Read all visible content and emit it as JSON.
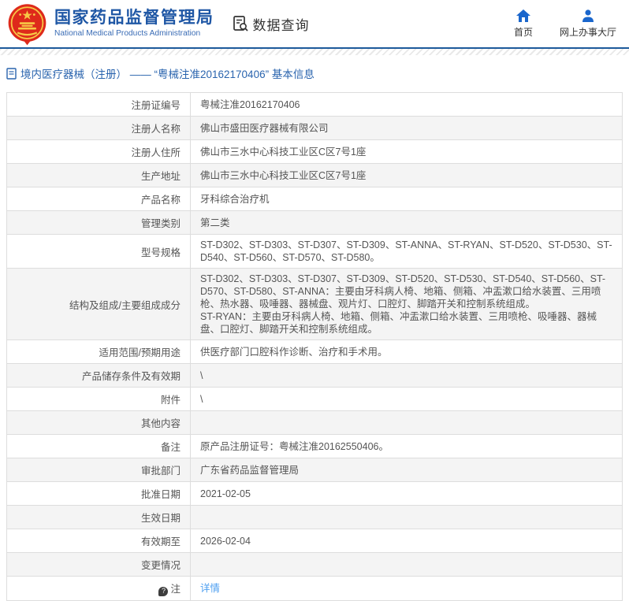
{
  "header": {
    "agency_name_cn": "国家药品监督管理局",
    "agency_name_en": "National Medical Products Administration",
    "section_title": "数据查询",
    "nav": [
      {
        "icon": "home-icon",
        "label": "首页"
      },
      {
        "icon": "user-icon",
        "label": "网上办事大厅"
      }
    ]
  },
  "breadcrumb": {
    "text": "境内医疗器械（注册） —— “粤械注准20162170406” 基本信息"
  },
  "table": {
    "rows": [
      {
        "label": "注册证编号",
        "value": "粤械注准20162170406"
      },
      {
        "label": "注册人名称",
        "value": "佛山市盛田医疗器械有限公司"
      },
      {
        "label": "注册人住所",
        "value": "佛山市三水中心科技工业区C区7号1座"
      },
      {
        "label": "生产地址",
        "value": "佛山市三水中心科技工业区C区7号1座"
      },
      {
        "label": "产品名称",
        "value": "牙科综合治疗机"
      },
      {
        "label": "管理类别",
        "value": "第二类"
      },
      {
        "label": "型号规格",
        "value": "ST-D302、ST-D303、ST-D307、ST-D309、ST-ANNA、ST-RYAN、ST-D520、ST-D530、ST-D540、ST-D560、ST-D570、ST-D580。"
      },
      {
        "label": "结构及组成/主要组成成分",
        "value": "ST-D302、ST-D303、ST-D307、ST-D309、ST-D520、ST-D530、ST-D540、ST-D560、ST-D570、ST-D580、ST-ANNA：主要由牙科病人椅、地箱、侧箱、冲盂漱口给水装置、三用喷枪、热水器、吸唾器、器械盘、观片灯、口腔灯、脚踏开关和控制系统组成。\nST-RYAN：主要由牙科病人椅、地箱、侧箱、冲盂漱口给水装置、三用喷枪、吸唾器、器械盘、口腔灯、脚踏开关和控制系统组成。"
      },
      {
        "label": "适用范围/预期用途",
        "value": "供医疗部门口腔科作诊断、治疗和手术用。"
      },
      {
        "label": "产品储存条件及有效期",
        "value": "\\"
      },
      {
        "label": "附件",
        "value": "\\"
      },
      {
        "label": "其他内容",
        "value": ""
      },
      {
        "label": "备注",
        "value": "原产品注册证号：粤械注准20162550406。"
      },
      {
        "label": "审批部门",
        "value": "广东省药品监督管理局"
      },
      {
        "label": "批准日期",
        "value": "2021-02-05"
      },
      {
        "label": "生效日期",
        "value": ""
      },
      {
        "label": "有效期至",
        "value": "2026-02-04"
      },
      {
        "label": "变更情况",
        "value": ""
      },
      {
        "label": "注",
        "icon": "note-icon",
        "value": "详情",
        "is_link": true
      }
    ]
  },
  "colors": {
    "title_blue": "#1f57a5",
    "header_border_blue": "#1d5a9b",
    "breadcrumb_blue": "#2a64ae",
    "icon_blue": "#1a66cc",
    "emblem_red": "#de2a1b",
    "emblem_gold": "#f7c846",
    "link_blue": "#4c9ef0",
    "alt_row_bg": "#f4f4f4",
    "table_border": "#dddddd"
  }
}
